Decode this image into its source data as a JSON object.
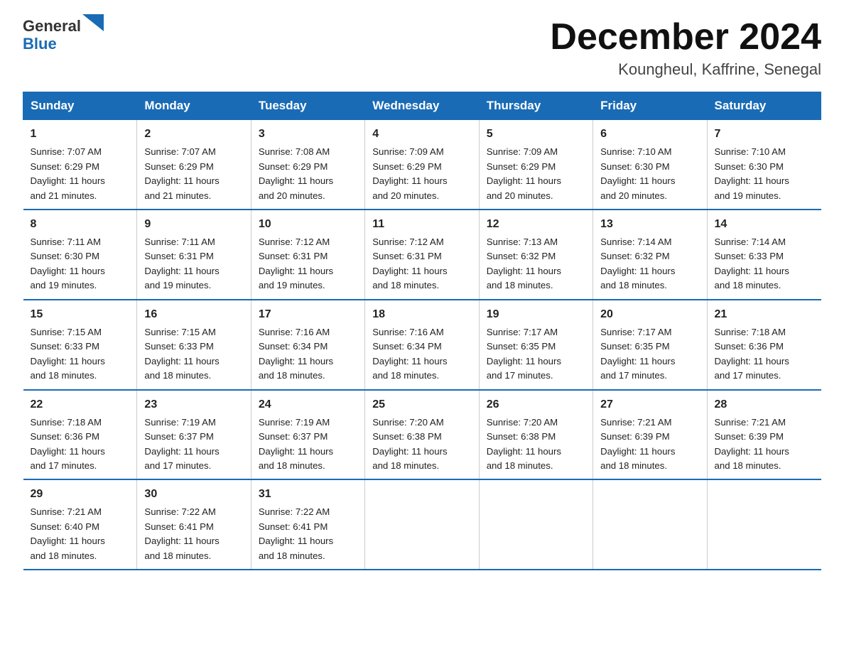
{
  "logo": {
    "text_general": "General",
    "text_blue": "Blue"
  },
  "header": {
    "month_title": "December 2024",
    "location": "Koungheul, Kaffrine, Senegal"
  },
  "days_of_week": [
    "Sunday",
    "Monday",
    "Tuesday",
    "Wednesday",
    "Thursday",
    "Friday",
    "Saturday"
  ],
  "weeks": [
    [
      {
        "day": "1",
        "sunrise": "7:07 AM",
        "sunset": "6:29 PM",
        "daylight": "11 hours and 21 minutes."
      },
      {
        "day": "2",
        "sunrise": "7:07 AM",
        "sunset": "6:29 PM",
        "daylight": "11 hours and 21 minutes."
      },
      {
        "day": "3",
        "sunrise": "7:08 AM",
        "sunset": "6:29 PM",
        "daylight": "11 hours and 20 minutes."
      },
      {
        "day": "4",
        "sunrise": "7:09 AM",
        "sunset": "6:29 PM",
        "daylight": "11 hours and 20 minutes."
      },
      {
        "day": "5",
        "sunrise": "7:09 AM",
        "sunset": "6:29 PM",
        "daylight": "11 hours and 20 minutes."
      },
      {
        "day": "6",
        "sunrise": "7:10 AM",
        "sunset": "6:30 PM",
        "daylight": "11 hours and 20 minutes."
      },
      {
        "day": "7",
        "sunrise": "7:10 AM",
        "sunset": "6:30 PM",
        "daylight": "11 hours and 19 minutes."
      }
    ],
    [
      {
        "day": "8",
        "sunrise": "7:11 AM",
        "sunset": "6:30 PM",
        "daylight": "11 hours and 19 minutes."
      },
      {
        "day": "9",
        "sunrise": "7:11 AM",
        "sunset": "6:31 PM",
        "daylight": "11 hours and 19 minutes."
      },
      {
        "day": "10",
        "sunrise": "7:12 AM",
        "sunset": "6:31 PM",
        "daylight": "11 hours and 19 minutes."
      },
      {
        "day": "11",
        "sunrise": "7:12 AM",
        "sunset": "6:31 PM",
        "daylight": "11 hours and 18 minutes."
      },
      {
        "day": "12",
        "sunrise": "7:13 AM",
        "sunset": "6:32 PM",
        "daylight": "11 hours and 18 minutes."
      },
      {
        "day": "13",
        "sunrise": "7:14 AM",
        "sunset": "6:32 PM",
        "daylight": "11 hours and 18 minutes."
      },
      {
        "day": "14",
        "sunrise": "7:14 AM",
        "sunset": "6:33 PM",
        "daylight": "11 hours and 18 minutes."
      }
    ],
    [
      {
        "day": "15",
        "sunrise": "7:15 AM",
        "sunset": "6:33 PM",
        "daylight": "11 hours and 18 minutes."
      },
      {
        "day": "16",
        "sunrise": "7:15 AM",
        "sunset": "6:33 PM",
        "daylight": "11 hours and 18 minutes."
      },
      {
        "day": "17",
        "sunrise": "7:16 AM",
        "sunset": "6:34 PM",
        "daylight": "11 hours and 18 minutes."
      },
      {
        "day": "18",
        "sunrise": "7:16 AM",
        "sunset": "6:34 PM",
        "daylight": "11 hours and 18 minutes."
      },
      {
        "day": "19",
        "sunrise": "7:17 AM",
        "sunset": "6:35 PM",
        "daylight": "11 hours and 17 minutes."
      },
      {
        "day": "20",
        "sunrise": "7:17 AM",
        "sunset": "6:35 PM",
        "daylight": "11 hours and 17 minutes."
      },
      {
        "day": "21",
        "sunrise": "7:18 AM",
        "sunset": "6:36 PM",
        "daylight": "11 hours and 17 minutes."
      }
    ],
    [
      {
        "day": "22",
        "sunrise": "7:18 AM",
        "sunset": "6:36 PM",
        "daylight": "11 hours and 17 minutes."
      },
      {
        "day": "23",
        "sunrise": "7:19 AM",
        "sunset": "6:37 PM",
        "daylight": "11 hours and 17 minutes."
      },
      {
        "day": "24",
        "sunrise": "7:19 AM",
        "sunset": "6:37 PM",
        "daylight": "11 hours and 18 minutes."
      },
      {
        "day": "25",
        "sunrise": "7:20 AM",
        "sunset": "6:38 PM",
        "daylight": "11 hours and 18 minutes."
      },
      {
        "day": "26",
        "sunrise": "7:20 AM",
        "sunset": "6:38 PM",
        "daylight": "11 hours and 18 minutes."
      },
      {
        "day": "27",
        "sunrise": "7:21 AM",
        "sunset": "6:39 PM",
        "daylight": "11 hours and 18 minutes."
      },
      {
        "day": "28",
        "sunrise": "7:21 AM",
        "sunset": "6:39 PM",
        "daylight": "11 hours and 18 minutes."
      }
    ],
    [
      {
        "day": "29",
        "sunrise": "7:21 AM",
        "sunset": "6:40 PM",
        "daylight": "11 hours and 18 minutes."
      },
      {
        "day": "30",
        "sunrise": "7:22 AM",
        "sunset": "6:41 PM",
        "daylight": "11 hours and 18 minutes."
      },
      {
        "day": "31",
        "sunrise": "7:22 AM",
        "sunset": "6:41 PM",
        "daylight": "11 hours and 18 minutes."
      },
      null,
      null,
      null,
      null
    ]
  ],
  "labels": {
    "sunrise": "Sunrise:",
    "sunset": "Sunset:",
    "daylight": "Daylight:"
  }
}
